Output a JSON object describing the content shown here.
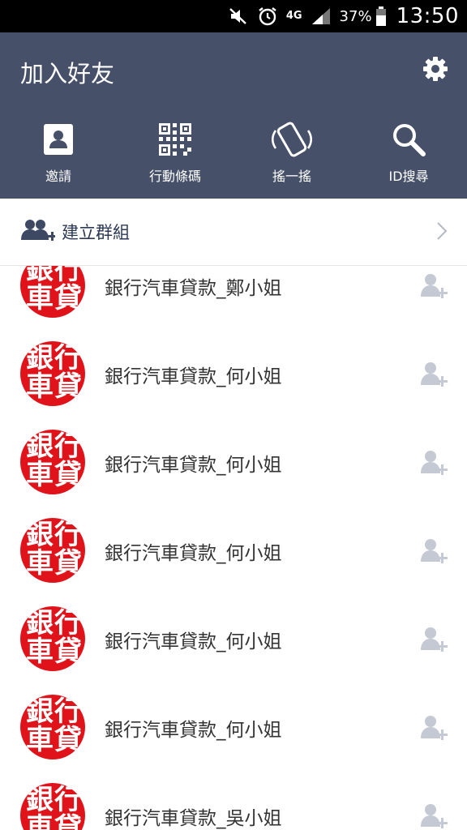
{
  "status_bar": {
    "network": "4G",
    "battery": "37%",
    "time": "13:50",
    "icons": [
      "mute-icon",
      "alarm-icon",
      "signal-icon",
      "battery-icon"
    ]
  },
  "header": {
    "title": "加入好友",
    "settings_icon": "gear-icon",
    "tools": [
      {
        "label": "邀請",
        "icon": "contacts-icon"
      },
      {
        "label": "行動條碼",
        "icon": "qr-code-icon"
      },
      {
        "label": "搖一搖",
        "icon": "shake-phone-icon"
      },
      {
        "label": "ID搜尋",
        "icon": "search-icon"
      }
    ]
  },
  "create_group": {
    "label": "建立群組",
    "icon": "add-group-icon"
  },
  "avatar_text": [
    "銀",
    "行",
    "車",
    "貸"
  ],
  "colors": {
    "header_bg": "#465068",
    "avatar_red": "#e0131b",
    "add_icon": "#c5c9d3"
  },
  "results": [
    {
      "name": "銀行汽車貸款_鄭小姐"
    },
    {
      "name": "銀行汽車貸款_何小姐"
    },
    {
      "name": "銀行汽車貸款_何小姐"
    },
    {
      "name": "銀行汽車貸款_何小姐"
    },
    {
      "name": "銀行汽車貸款_何小姐"
    },
    {
      "name": "銀行汽車貸款_何小姐"
    },
    {
      "name": "銀行汽車貸款_吳小姐"
    }
  ]
}
